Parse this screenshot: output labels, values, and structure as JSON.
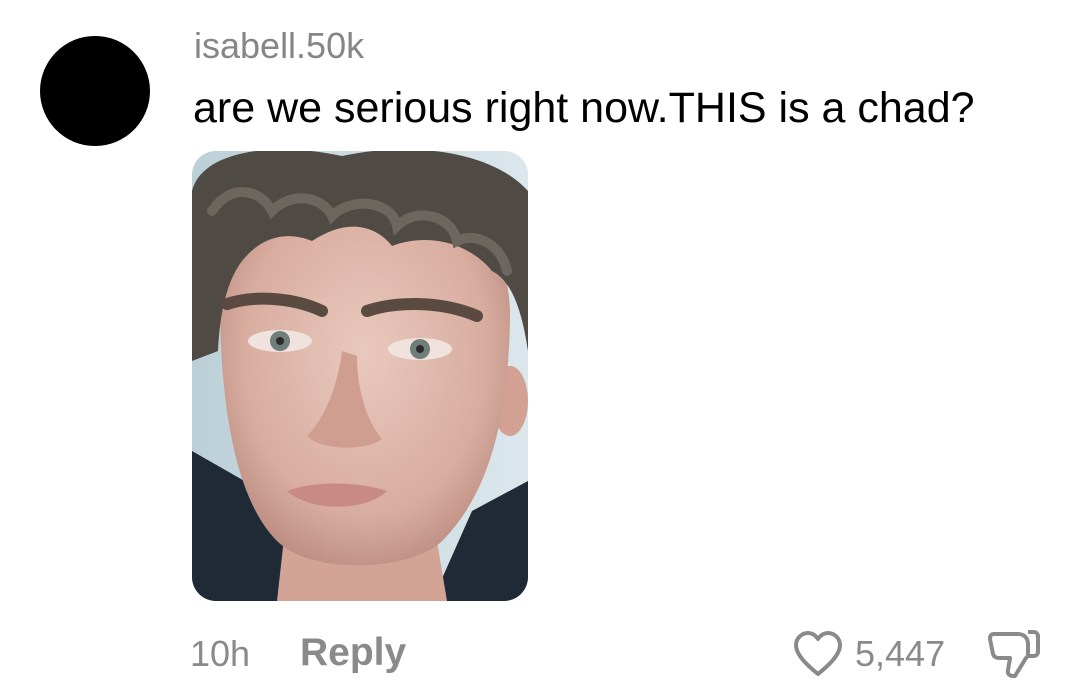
{
  "comment": {
    "username": "isabell.50k",
    "text": "are we serious right now.THIS is a chad?",
    "timestamp": "10h",
    "reply_label": "Reply",
    "like_count": "5,447",
    "avatar_color": "#000000",
    "icons": {
      "like": "heart-icon",
      "dislike": "thumbs-down-icon"
    },
    "attachment": {
      "kind": "photo",
      "subject": "portrait-photo"
    }
  }
}
